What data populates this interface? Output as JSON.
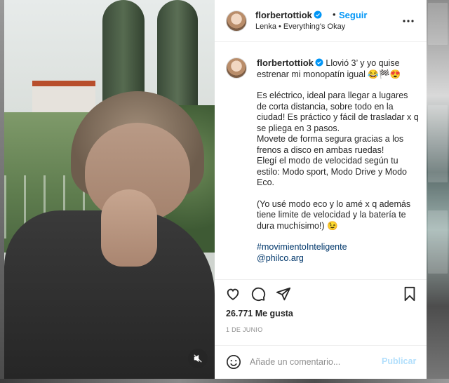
{
  "post": {
    "username": "florbertottiok",
    "follow_label": "Seguir",
    "separator": "•",
    "location": "Lenka • Everything's Okay",
    "caption": {
      "username": "florbertottiok",
      "intro": "Llovió 3’ y yo quise estrenar mi monopatín igual 😂🏁😍",
      "para1": "Es eléctrico, ideal para llegar a lugares de corta distancia, sobre todo en la ciudad! Es práctico y fácil de trasladar x q se pliega en 3 pasos.",
      "para1b": "Movete de forma segura gracias a los frenos a disco en ambas ruedas!",
      "para1c": "Elegí el modo de velocidad según tu estilo: Modo sport, Modo Drive y Modo Eco.",
      "para2": "(Yo usé modo eco y lo amé x q además tiene limite de velocidad y la batería te dura muchísimo!) 😉",
      "hashtag": "#movimientoInteligente",
      "mention": "@philco.arg"
    },
    "likes": "26.771 Me gusta",
    "date": "1 DE JUNIO",
    "comment_placeholder": "Añade un comentario...",
    "publish_label": "Publicar"
  },
  "icons": {
    "verified": "verified-badge-icon",
    "more": "more-options-icon",
    "like": "heart-icon",
    "comment": "comment-icon",
    "share": "paper-plane-icon",
    "save": "bookmark-icon",
    "emoji": "smiley-icon",
    "mute": "speaker-muted-icon"
  },
  "colors": {
    "accent": "#0095f6",
    "publish_disabled": "#b2dffc",
    "link": "#00376b",
    "muted_text": "#8e8e8e"
  }
}
